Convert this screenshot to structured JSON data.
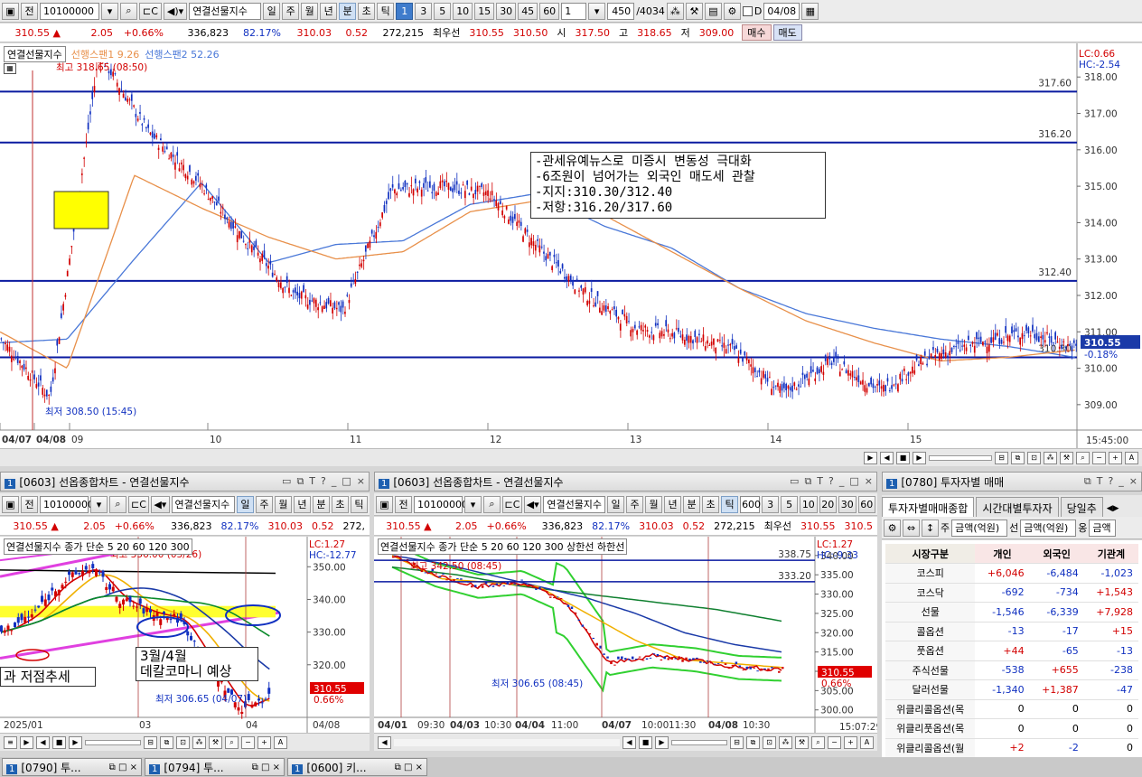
{
  "main_toolbar": {
    "code": "10100000",
    "name": "연결선물지수",
    "periods": [
      "일",
      "주",
      "월",
      "년",
      "분",
      "초",
      "틱"
    ],
    "active_period": "분",
    "intervals": [
      "1",
      "3",
      "5",
      "10",
      "15",
      "30",
      "45",
      "60"
    ],
    "active_interval": "1",
    "unit": "1",
    "count": "450",
    "total": "/4034",
    "chk_label": "D",
    "date": "04/08"
  },
  "main_quote": {
    "price": "310.55 ▲",
    "change": "2.05",
    "pct": "+0.66%",
    "volume": "336,823",
    "ratio": "82.17%",
    "bid": "310.03",
    "bid_chg": "0.52",
    "oi": "272,215",
    "best_label": "최우선",
    "best_ask": "310.55",
    "best_bid": "310.50",
    "open_label": "시",
    "open": "317.50",
    "high_label": "고",
    "high": "318.65",
    "low_label": "저",
    "low": "309.00",
    "buy": "매수",
    "sell": "매도"
  },
  "main_chart": {
    "legend_name": "연결선물지수",
    "legend_s1": "선행스팬1 9.26",
    "legend_s2": "선행스팬2 52.26",
    "lc": "LC:0.66",
    "hc": "HC:-2.54",
    "high_note": "최고 318.65 (08:50)",
    "low_note": "최저 308.50 (15:45)",
    "price_tag": "310.55",
    "pct_tag": "-0.18%",
    "levels": [
      "317.60",
      "316.20",
      "312.40",
      "310.30"
    ],
    "yticks": [
      "318.00",
      "317.00",
      "316.00",
      "315.00",
      "314.00",
      "313.00",
      "312.00",
      "311.00",
      "310.00",
      "309.00"
    ],
    "xticks": [
      "04/07",
      "04/08",
      "09",
      "10",
      "11",
      "12",
      "13",
      "14",
      "15"
    ],
    "time_now": "15:45:00",
    "memo": [
      "-관세유예뉴스로 미증시 변동성 극대화",
      "-6조원이 넘어가는 외국인 매도세 관찰",
      "-지지:310.30/312.40",
      "-저항:316.20/317.60"
    ]
  },
  "chart_data": [
    {
      "type": "line",
      "title": "연결선물지수 1분",
      "series": [
        {
          "name": "연결선물지수",
          "values": [
            310.8,
            309.2,
            318.65,
            316.5,
            315.2,
            313.5,
            312.0,
            311.6,
            314.9,
            315.0,
            314.8,
            313.3,
            312.0,
            311.1,
            310.9,
            310.5,
            309.3,
            310.2,
            309.4,
            310.3,
            310.7,
            311.0,
            310.55
          ]
        },
        {
          "name": "선행스팬1",
          "values": [
            311.0,
            310.0,
            315.3,
            314.4,
            313.6,
            313.0,
            313.2,
            314.3,
            314.6,
            314.2,
            313.2,
            312.2,
            311.3,
            310.7,
            310.2,
            310.3,
            310.5
          ]
        },
        {
          "name": "선행스팬2",
          "values": [
            310.7,
            310.8,
            313.0,
            315.1,
            312.9,
            313.4,
            313.5,
            314.5,
            314.8,
            313.9,
            313.3,
            312.2,
            311.5,
            311.1,
            310.8,
            310.6,
            310.3
          ]
        }
      ],
      "ylim": [
        308.5,
        318.8
      ]
    },
    {
      "type": "line",
      "title": "연결선물지수 일",
      "x": [
        "2025/01",
        "03",
        "04"
      ],
      "series": [
        {
          "name": "종가",
          "values": [
            330,
            335,
            345,
            350,
            340,
            336,
            334,
            320,
            306.65,
            310.55
          ]
        }
      ],
      "ylim": [
        305,
        355
      ]
    },
    {
      "type": "line",
      "title": "연결선물지수 틱",
      "x": [
        "04/01",
        "04/03",
        "04/04",
        "04/07",
        "04/08"
      ],
      "series": [
        {
          "name": "종가",
          "values": [
            340,
            335,
            332,
            333,
            328,
            312,
            314,
            313,
            311,
            310.55
          ]
        }
      ],
      "ylim": [
        300,
        343
      ]
    }
  ],
  "left_window": {
    "title": "[0603] 선옵종합차트 - 연결선물지수",
    "code": "10100000",
    "name": "연결선물지수",
    "periods": [
      "일",
      "주",
      "월",
      "년",
      "분",
      "초",
      "틱"
    ],
    "quote": {
      "price": "310.55 ▲",
      "change": "2.05",
      "pct": "+0.66%",
      "volume": "336,823",
      "ratio": "82.17%",
      "bid": "310.03",
      "bid_chg": "0.52",
      "oi": "272,"
    },
    "legend": "연결선물지수 종가 단순 5 20 60 120 300",
    "lc": "LC:1.27",
    "hc": "HC:-12.77",
    "high_note": "최고 356.00 (03/26)",
    "low_note": "최저 306.65 (04/07)",
    "note1": "3월/4월",
    "note2": "데칼코마니 예상",
    "note3": "과 저점추세",
    "price_tag": "310.55",
    "pct_tag": "0.66%",
    "yticks": [
      "350.00",
      "340.00",
      "330.00",
      "320.00"
    ],
    "xticks": [
      "2025/01",
      "03",
      "04",
      "04/08"
    ]
  },
  "mid_window": {
    "title": "[0603] 선옵종합차트 - 연결선물지수",
    "code": "10100000",
    "name": "연결선물지수",
    "periods": [
      "일",
      "주",
      "월",
      "년",
      "분",
      "초",
      "틱"
    ],
    "intervals": [
      "3",
      "5",
      "10",
      "20",
      "30",
      "60"
    ],
    "interval_box": "600",
    "quote": {
      "price": "310.55 ▲",
      "change": "2.05",
      "pct": "+0.66%",
      "volume": "336,823",
      "ratio": "82.17%",
      "bid": "310.03",
      "bid_chg": "0.52",
      "oi": "272,215",
      "best_label": "최우선",
      "best_ask": "310.55",
      "best_bid": "310.5"
    },
    "legend": "연결선물지수 종가 단순 5 20 60 120 300 상한선 하한선",
    "lc": "LC:1.27",
    "hc": "HC:-9.33",
    "high_note": "최고 342.50 (08:45)",
    "low_note": "최저 306.65 (08:45)",
    "levels": [
      "338.75",
      "333.20"
    ],
    "price_tag": "310.55",
    "pct_tag": "0.66%",
    "yticks": [
      "340.00",
      "335.00",
      "330.00",
      "325.00",
      "320.00",
      "315.00",
      "310.00",
      "305.00",
      "300.00"
    ],
    "xticks": [
      "04/01",
      "09:30",
      "04/03",
      "10:30",
      "04/04",
      "11:00",
      "04/07",
      "10:00",
      "11:30",
      "04/08",
      "10:30"
    ],
    "time_now": "15:07:29"
  },
  "inv_window": {
    "title": "[0780] 투자자별 매매",
    "tabs": [
      "투자자별매매종합",
      "시간대별투자자",
      "당일추"
    ],
    "sel1": "금액(억원)",
    "sel2": "금액(억원)",
    "sel3": "금액",
    "headers": [
      "시장구분",
      "개인",
      "외국인",
      "기관계"
    ],
    "rows": [
      [
        "코스피",
        "+6,046",
        "-6,484",
        "-1,023"
      ],
      [
        "코스닥",
        "-692",
        "-734",
        "+1,543"
      ],
      [
        "선물",
        "-1,546",
        "-6,339",
        "+7,928"
      ],
      [
        "콜옵션",
        "-13",
        "-17",
        "+15"
      ],
      [
        "풋옵션",
        "+44",
        "-65",
        "-13"
      ],
      [
        "주식선물",
        "-538",
        "+655",
        "-238"
      ],
      [
        "달러선물",
        "-1,340",
        "+1,387",
        "-47"
      ],
      [
        "위클리콜옵션(목",
        "0",
        "0",
        "0"
      ],
      [
        "위클리풋옵션(목",
        "0",
        "0",
        "0"
      ],
      [
        "위클리콜옵션(월",
        "+2",
        "-2",
        "0"
      ],
      [
        "위클리풋옵션(월",
        "+1",
        "-1",
        "0"
      ]
    ]
  },
  "taskbar": [
    {
      "num": "1",
      "label": "[0790] 투..."
    },
    {
      "num": "1",
      "label": "[0794] 투..."
    },
    {
      "num": "1",
      "label": "[0600] 키..."
    }
  ],
  "colors": {
    "up": "#d20000",
    "down": "#1030c0",
    "span1": "#e8904a",
    "span2": "#4a78d8",
    "level": "#0a1aa0"
  }
}
